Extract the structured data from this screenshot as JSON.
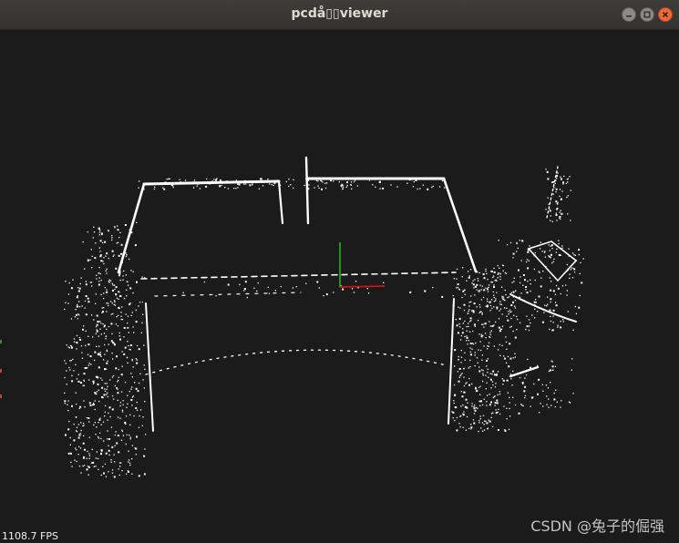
{
  "window": {
    "title": "pcdå▯▯viewer"
  },
  "viewer": {
    "fps_text": "1108.7 FPS",
    "axes": {
      "x_color": "#c81414",
      "y_color": "#18c818"
    },
    "point_color": "#ffffff",
    "background_color": "#1b1b1b"
  },
  "watermark": {
    "text": "CSDN @兔子的倔强"
  },
  "icons": {
    "minimize": "minimize-icon",
    "maximize": "maximize-icon",
    "close": "close-icon"
  }
}
